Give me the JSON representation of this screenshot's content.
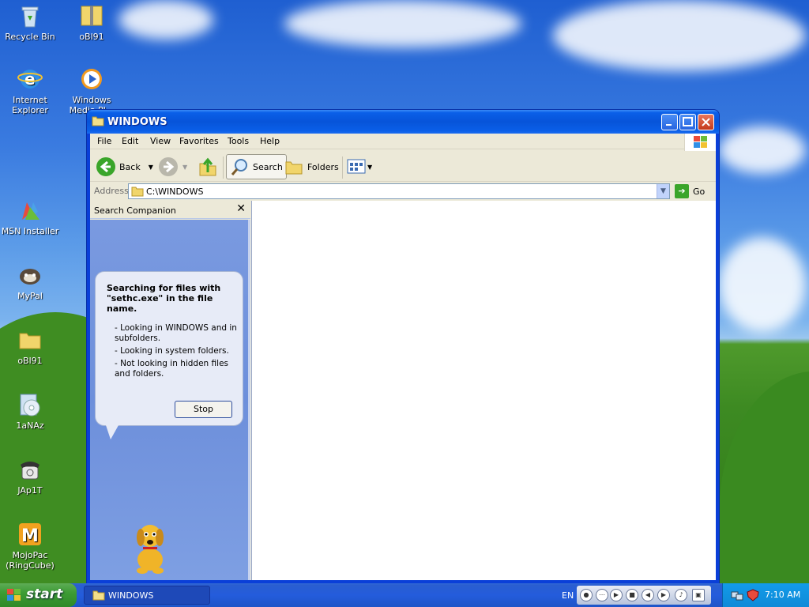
{
  "desktop": {
    "icons": [
      {
        "label": "Recycle Bin",
        "icon": "recycle-bin-icon"
      },
      {
        "label": "oBl91",
        "icon": "zip-folder-icon"
      },
      {
        "label": "Internet Explorer",
        "icon": "internet-explorer-icon"
      },
      {
        "label": "Windows Media Pl...",
        "icon": "media-player-icon"
      },
      {
        "label": "MSN Installer",
        "icon": "msn-icon"
      },
      {
        "label": "MyPal",
        "icon": "mypal-icon"
      },
      {
        "label": "oBl91",
        "icon": "folder-icon"
      },
      {
        "label": "1aNAz",
        "icon": "cd-icon"
      },
      {
        "label": "JAp1T",
        "icon": "phone-icon"
      },
      {
        "label": "MojoPac (RingCube)",
        "icon": "mojopac-icon"
      }
    ]
  },
  "window": {
    "title": "WINDOWS",
    "menu": [
      "File",
      "Edit",
      "View",
      "Favorites",
      "Tools",
      "Help"
    ],
    "toolbar": {
      "back": "Back",
      "search": "Search",
      "folders": "Folders"
    },
    "address": {
      "label": "Address",
      "value": "C:\\WINDOWS",
      "go": "Go"
    },
    "search_companion": {
      "title": "Search Companion",
      "heading": "Searching for files with \"sethc.exe\" in the file name.",
      "items": [
        "- Looking in WINDOWS and in subfolders.",
        "- Looking in system folders.",
        "- Not looking in hidden files and folders."
      ],
      "stop": "Stop"
    }
  },
  "taskbar": {
    "start": "start",
    "task": "WINDOWS",
    "lang": "EN",
    "time": "7:10 AM"
  }
}
